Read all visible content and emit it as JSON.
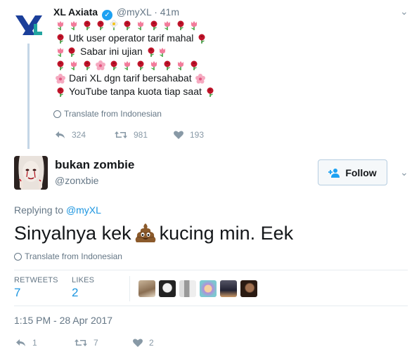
{
  "parent_tweet": {
    "author_name": "XL Axiata",
    "handle": "@myXL",
    "separator": "·",
    "time": "41m",
    "lines": [
      "Utk user operator tarif mahal",
      "Sabar ini ujian",
      "Dari XL dgn tarif bersahabat",
      "YouTube tanpa kuota tiap saat"
    ],
    "translate_label": "Translate from Indonesian",
    "reply_count": "324",
    "retweet_count": "981",
    "like_count": "193"
  },
  "main_tweet": {
    "author_name": "bukan zombie",
    "handle": "@zonxbie",
    "follow_label": "Follow",
    "replying_prefix": "Replying to",
    "replying_handle": "@myXL",
    "text_before": "Sinyalnya kek",
    "text_after": "kucing min. Eek",
    "translate_label": "Translate from Indonesian",
    "retweets_label": "RETWEETS",
    "retweets_value": "7",
    "likes_label": "LIKES",
    "likes_value": "2",
    "timestamp": "1:15 PM - 28 Apr 2017",
    "reply_count": "1",
    "retweet_count": "7",
    "like_count": "2"
  },
  "icons": {
    "verified": "verified-badge-icon",
    "reply": "reply-icon",
    "retweet": "retweet-icon",
    "like": "heart-icon",
    "globe": "globe-icon",
    "caret": "chevron-down-icon",
    "follow": "add-user-icon"
  },
  "colors": {
    "accent": "#1da1f2",
    "link": "#1b95e0",
    "muted": "#657786",
    "thread_line": "#c4d6e6",
    "divider": "#e6ecf0"
  }
}
